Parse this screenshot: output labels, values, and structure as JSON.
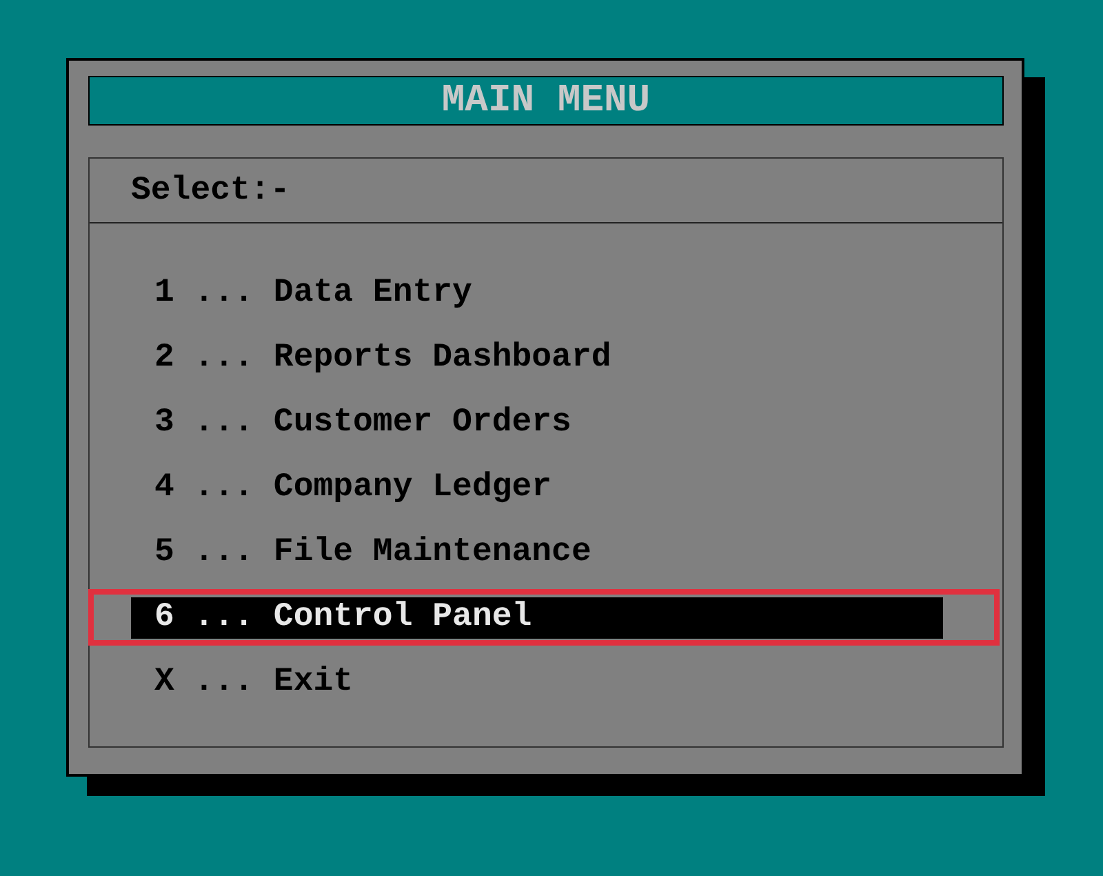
{
  "window": {
    "title": "MAIN MENU"
  },
  "prompt": "Select:-",
  "items": [
    {
      "label": "1 ... Data Entry",
      "selected": false
    },
    {
      "label": "2 ... Reports Dashboard",
      "selected": false
    },
    {
      "label": "3 ... Customer Orders",
      "selected": false
    },
    {
      "label": "4 ... Company Ledger",
      "selected": false
    },
    {
      "label": "5 ... File Maintenance",
      "selected": false
    },
    {
      "label": "6 ... Control Panel",
      "selected": true
    },
    {
      "label": "X ... Exit",
      "selected": false
    }
  ]
}
